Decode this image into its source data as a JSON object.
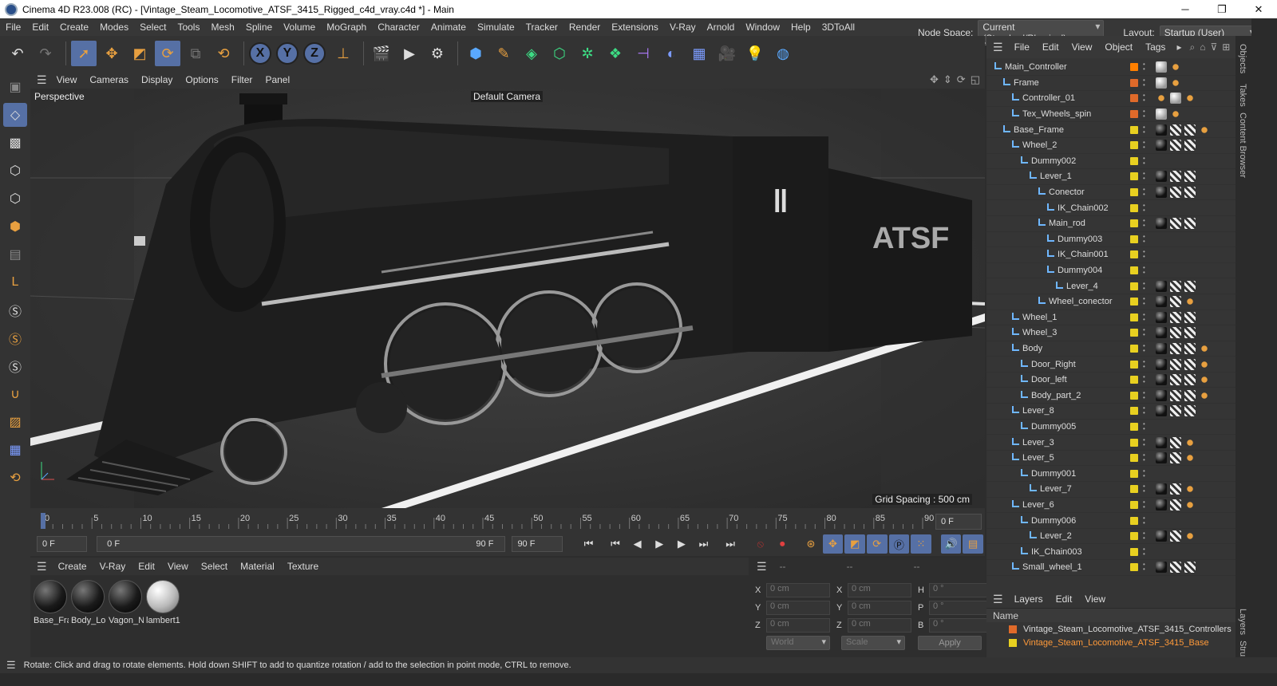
{
  "window": {
    "title": "Cinema 4D R23.008 (RC) - [Vintage_Steam_Locomotive_ATSF_3415_Rigged_c4d_vray.c4d *] - Main",
    "minimize": "─",
    "maximize": "❐",
    "close": "✕"
  },
  "menu": [
    "File",
    "Edit",
    "Create",
    "Modes",
    "Select",
    "Tools",
    "Mesh",
    "Spline",
    "Volume",
    "MoGraph",
    "Character",
    "Animate",
    "Simulate",
    "Tracker",
    "Render",
    "Extensions",
    "V-Ray",
    "Arnold",
    "Window",
    "Help",
    "3DToAll"
  ],
  "nodespace": {
    "label": "Node Space:",
    "value": "Current (Standard/Physical)"
  },
  "layout": {
    "label": "Layout:",
    "value": "Startup (User)"
  },
  "toolbar": {
    "x": "X",
    "y": "Y",
    "z": "Z"
  },
  "viewport_menu": [
    "View",
    "Cameras",
    "Display",
    "Options",
    "Filter",
    "Panel"
  ],
  "viewport": {
    "perspective": "Perspective",
    "camera": "Default Camera",
    "grid_spacing": "Grid Spacing : 500 cm"
  },
  "timeline": {
    "ticks": [
      "0",
      "5",
      "10",
      "15",
      "20",
      "25",
      "30",
      "35",
      "40",
      "45",
      "50",
      "55",
      "60",
      "65",
      "70",
      "75",
      "80",
      "85",
      "90"
    ],
    "current_frame": "0 F",
    "start_frame": "0 F",
    "range_start": "0 F",
    "range_end": "90 F",
    "end_frame": "90 F"
  },
  "material_menu": [
    "Create",
    "V-Ray",
    "Edit",
    "View",
    "Select",
    "Material",
    "Texture"
  ],
  "materials": [
    {
      "name": "Base_Fra",
      "type": "dark"
    },
    {
      "name": "Body_Lo",
      "type": "dark"
    },
    {
      "name": "Vagon_N",
      "type": "dark"
    },
    {
      "name": "lambert1",
      "type": "white"
    }
  ],
  "coords": {
    "header": [
      "--",
      "--",
      "--"
    ],
    "rows": [
      {
        "a": "X",
        "av": "0 cm",
        "b": "X",
        "bv": "0 cm",
        "c": "H",
        "cv": "0 °"
      },
      {
        "a": "Y",
        "av": "0 cm",
        "b": "Y",
        "bv": "0 cm",
        "c": "P",
        "cv": "0 °"
      },
      {
        "a": "Z",
        "av": "0 cm",
        "b": "Z",
        "bv": "0 cm",
        "c": "B",
        "cv": "0 °"
      }
    ],
    "world": "World",
    "scale": "Scale",
    "apply": "Apply"
  },
  "status": "Rotate: Click and drag to rotate elements. Hold down SHIFT to add to quantize rotation / add to the selection in point mode, CTRL to remove.",
  "object_menu": [
    "File",
    "Edit",
    "View",
    "Object",
    "Tags"
  ],
  "objects": [
    {
      "name": "Main_Controller",
      "depth": 0,
      "layer": "#ff8000",
      "tags": [
        "w",
        "o"
      ]
    },
    {
      "name": "Frame",
      "depth": 1,
      "layer": "#e06a2a",
      "tags": [
        "w",
        "o"
      ]
    },
    {
      "name": "Controller_01",
      "depth": 2,
      "layer": "#e06a2a",
      "tags": [
        "o",
        "w",
        "o"
      ]
    },
    {
      "name": "Tex_Wheels_spin",
      "depth": 2,
      "layer": "#e06a2a",
      "tags": [
        "w",
        "o"
      ]
    },
    {
      "name": "Base_Frame",
      "depth": 1,
      "layer": "#e8d020",
      "tags": [
        "s",
        "c",
        "c",
        "o"
      ]
    },
    {
      "name": "Wheel_2",
      "depth": 2,
      "layer": "#e8d020",
      "tags": [
        "s",
        "c",
        "c"
      ]
    },
    {
      "name": "Dummy002",
      "depth": 3,
      "layer": "#e8d020",
      "tags": []
    },
    {
      "name": "Lever_1",
      "depth": 4,
      "layer": "#e8d020",
      "tags": [
        "s",
        "c",
        "c"
      ]
    },
    {
      "name": "Conector",
      "depth": 5,
      "layer": "#e8d020",
      "tags": [
        "s",
        "c",
        "c"
      ]
    },
    {
      "name": "IK_Chain002",
      "depth": 6,
      "layer": "#e8d020",
      "tags": []
    },
    {
      "name": "Main_rod",
      "depth": 5,
      "layer": "#e8d020",
      "tags": [
        "s",
        "c",
        "c"
      ]
    },
    {
      "name": "Dummy003",
      "depth": 6,
      "layer": "#e8d020",
      "tags": []
    },
    {
      "name": "IK_Chain001",
      "depth": 6,
      "layer": "#e8d020",
      "tags": []
    },
    {
      "name": "Dummy004",
      "depth": 6,
      "layer": "#e8d020",
      "tags": []
    },
    {
      "name": "Lever_4",
      "depth": 7,
      "layer": "#e8d020",
      "tags": [
        "s",
        "c",
        "c"
      ]
    },
    {
      "name": "Wheel_conector",
      "depth": 5,
      "layer": "#e8d020",
      "tags": [
        "s",
        "c",
        "o"
      ]
    },
    {
      "name": "Wheel_1",
      "depth": 2,
      "layer": "#e8d020",
      "tags": [
        "s",
        "c",
        "c"
      ]
    },
    {
      "name": "Wheel_3",
      "depth": 2,
      "layer": "#e8d020",
      "tags": [
        "s",
        "c",
        "c"
      ]
    },
    {
      "name": "Body",
      "depth": 2,
      "layer": "#e8d020",
      "tags": [
        "s",
        "c",
        "c",
        "o"
      ]
    },
    {
      "name": "Door_Right",
      "depth": 3,
      "layer": "#e8d020",
      "tags": [
        "s",
        "c",
        "c",
        "o"
      ]
    },
    {
      "name": "Door_left",
      "depth": 3,
      "layer": "#e8d020",
      "tags": [
        "s",
        "c",
        "c",
        "o"
      ]
    },
    {
      "name": "Body_part_2",
      "depth": 3,
      "layer": "#e8d020",
      "tags": [
        "s",
        "c",
        "c",
        "o"
      ]
    },
    {
      "name": "Lever_8",
      "depth": 2,
      "layer": "#e8d020",
      "tags": [
        "s",
        "c",
        "c"
      ]
    },
    {
      "name": "Dummy005",
      "depth": 3,
      "layer": "#e8d020",
      "tags": []
    },
    {
      "name": "Lever_3",
      "depth": 2,
      "layer": "#e8d020",
      "tags": [
        "s",
        "c",
        "o"
      ]
    },
    {
      "name": "Lever_5",
      "depth": 2,
      "layer": "#e8d020",
      "tags": [
        "s",
        "c",
        "o"
      ]
    },
    {
      "name": "Dummy001",
      "depth": 3,
      "layer": "#e8d020",
      "tags": []
    },
    {
      "name": "Lever_7",
      "depth": 4,
      "layer": "#e8d020",
      "tags": [
        "s",
        "c",
        "o"
      ]
    },
    {
      "name": "Lever_6",
      "depth": 2,
      "layer": "#e8d020",
      "tags": [
        "s",
        "c",
        "o"
      ]
    },
    {
      "name": "Dummy006",
      "depth": 3,
      "layer": "#e8d020",
      "tags": []
    },
    {
      "name": "Lever_2",
      "depth": 4,
      "layer": "#e8d020",
      "tags": [
        "s",
        "c",
        "o"
      ]
    },
    {
      "name": "IK_Chain003",
      "depth": 3,
      "layer": "#e8d020",
      "tags": []
    },
    {
      "name": "Small_wheel_1",
      "depth": 2,
      "layer": "#e8d020",
      "tags": [
        "s",
        "c",
        "c"
      ]
    }
  ],
  "layer_menu": [
    "Layers",
    "Edit",
    "View"
  ],
  "layers": {
    "header": "Name",
    "items": [
      {
        "name": "Vintage_Steam_Locomotive_ATSF_3415_Controllers",
        "color": "#e06a2a",
        "text": "#dddddd"
      },
      {
        "name": "Vintage_Steam_Locomotive_ATSF_3415_Base",
        "color": "#e8d020",
        "text": "#ff9a3a"
      }
    ]
  },
  "side_tabs": [
    "Objects",
    "Takes",
    "Content Browser",
    "Layers",
    "Stru"
  ]
}
